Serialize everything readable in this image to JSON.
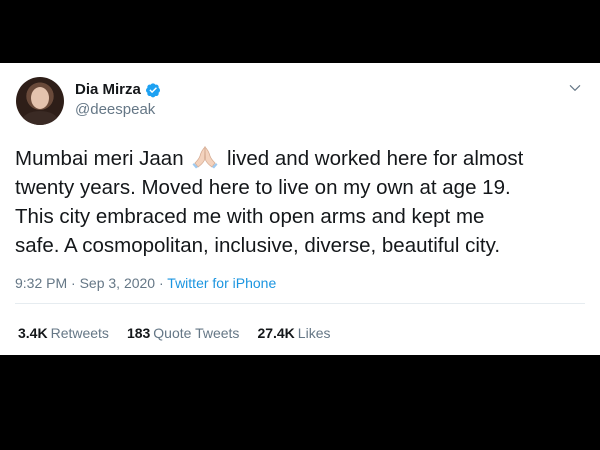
{
  "tweet": {
    "author": {
      "display_name": "Dia Mirza",
      "handle": "@deespeak",
      "verified": true
    },
    "text_lines": {
      "line1_before_emoji": "Mumbai meri Jaan",
      "line1_after_emoji": "lived and worked here for almost",
      "line2": "twenty years. Moved here to live on my own at age 19.",
      "line3": "This city embraced me with open arms and kept me",
      "line4": "safe. A cosmopolitan, inclusive, diverse, beautiful city."
    },
    "emoji": "folded-hands",
    "timestamp": "9:32 PM · Sep 3, 2020",
    "separator": " · ",
    "source": "Twitter for iPhone",
    "stats": {
      "retweets_count": "3.4K",
      "retweets_label": "Retweets",
      "quotes_count": "183",
      "quotes_label": "Quote Tweets",
      "likes_count": "27.4K",
      "likes_label": "Likes"
    }
  },
  "colors": {
    "background": "#000000",
    "card": "#ffffff",
    "text": "#14171a",
    "secondary": "#657786",
    "link": "#1b95e0",
    "verified": "#1da1f2"
  },
  "icons": {
    "verified": "verified-badge-icon",
    "menu": "chevron-down-icon"
  }
}
